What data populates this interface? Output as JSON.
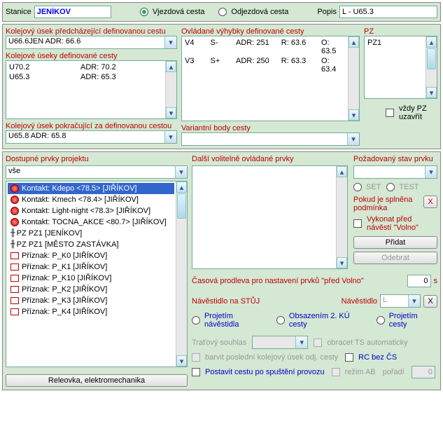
{
  "top": {
    "stanice_label": "Stanice",
    "stanice_value": "JENÍKOV",
    "vjezdova": "Vjezdová cesta",
    "odjezdova": "Odjezdová cesta",
    "popis_label": "Popis",
    "popis_value": "L - U65.3"
  },
  "sec1": {
    "kol_pred": "Kolejový úsek předcházející definovanou cestu",
    "pred_value": "U66.6JEN   ADR: 66.6",
    "kol_def": "Kolejové úseky definované cesty",
    "def_rows": [
      {
        "a": "U70.2",
        "b": "ADR: 70.2"
      },
      {
        "a": "U65.3",
        "b": "ADR: 65.3"
      }
    ],
    "kol_pokr": "Kolejový úsek pokračující za definovanou cestou",
    "pokr_value": "U65.8   ADR: 65.8",
    "vyhybky": "Ovládané výhybky definované cesty",
    "vyh_rows": [
      {
        "c0": "V4",
        "c1": "S-",
        "c2": "ADR: 251",
        "c3": "R: 63.6",
        "c4": "O: 63.5"
      },
      {
        "c0": "V3",
        "c1": "S+",
        "c2": "ADR: 250",
        "c3": "R: 63.3",
        "c4": "O: 63.4"
      }
    ],
    "variantni": "Variantní body cesty",
    "pz_label": "PZ",
    "pz_rows": [
      "PZ1"
    ],
    "pz_check": "vždy PZ uzavřít"
  },
  "sec2": {
    "dostupne": "Dostupné prvky projektu",
    "combo_value": "vše",
    "dalsi": "Další volitelně ovládané prvky",
    "pozadovany": "Požadovaný stav prvku",
    "set": "SET",
    "test": "TEST",
    "pokud": "Pokud je splněna podmínka",
    "vykonat": "Vykonat před  návěstí \"Volno\"",
    "pridat": "Přidat",
    "odebrat": "Odebrat",
    "casova": "Časová prodleva pro nastavení prvků \"před Volno\"",
    "casova_val": "0",
    "casova_unit": "s",
    "navest_label": "Návěstidlo na STŮJ",
    "navestidlo": "Návěstidlo",
    "navest_val": "L",
    "r1": "Projetím návěstidla",
    "r2": "Obsazením 2. KÚ cesty",
    "r3": "Projetím cesty",
    "tratovy": "Traťový souhlas",
    "obracet": "obracet TS automaticky",
    "barvit": "barvit poslední kolejový úsek odj. cesty",
    "rc": "RC bez ČS",
    "postavit": "Postavit cestu po spuštění provozu",
    "rezim": "režim AB",
    "poradi": "pořadí",
    "poradi_val": "0",
    "releovka": "Releovka, elektromechanika",
    "items": [
      "Kontakt: Kdepo <78.5> [JIŘÍKOV]",
      "Kontakt: Kmech <78.4> [JIŘÍKOV]",
      "Kontakt: Light-night <78.3> [JIŘÍKOV]",
      "Kontakt: TOCNA_AKCE <80.7> [JIŘÍKOV]",
      "PZ PZ1 [JENÍKOV]",
      "PZ PZ1 [MĚSTO ZASTÁVKA]",
      "Příznak: P_K0 [JIŘÍKOV]",
      "Příznak: P_K1 [JIŘÍKOV]",
      "Příznak: P_K10 [JIŘÍKOV]",
      "Příznak: P_K2 [JIŘÍKOV]",
      "Příznak: P_K3 [JIŘÍKOV]",
      "Příznak: P_K4 [JIŘÍKOV]"
    ]
  }
}
